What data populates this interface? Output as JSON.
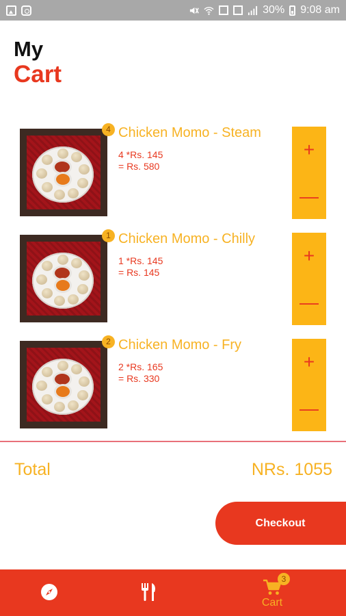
{
  "status_bar": {
    "battery": "30%",
    "time": "9:08 am",
    "icons": [
      "gallery-icon",
      "instagram-icon",
      "mute-icon",
      "wifi-icon",
      "nfc-icon",
      "sim-icon",
      "signal-icon",
      "battery-icon"
    ]
  },
  "header": {
    "title_line1": "My",
    "title_line2": "Cart"
  },
  "cart": {
    "items": [
      {
        "quantity": "4",
        "name": "Chicken Momo - Steam",
        "calc": "4 *Rs. 145",
        "subtotal": "= Rs. 580"
      },
      {
        "quantity": "1",
        "name": "Chicken Momo - Chilly",
        "calc": "1 *Rs. 145",
        "subtotal": "= Rs. 145"
      },
      {
        "quantity": "2",
        "name": "Chicken Momo - Fry",
        "calc": "2 *Rs. 165",
        "subtotal": "= Rs. 330"
      }
    ],
    "plus_label": "+",
    "minus_label": "—"
  },
  "summary": {
    "total_label": "Total",
    "total_value": "NRs. 1055",
    "checkout_label": "Checkout"
  },
  "bottom_nav": {
    "items": [
      {
        "icon": "compass-icon"
      },
      {
        "icon": "fork-knife-icon"
      },
      {
        "icon": "cart-icon",
        "label": "Cart",
        "badge": "3"
      }
    ]
  },
  "colors": {
    "accent_red": "#e8381f",
    "accent_yellow": "#f7b223",
    "stepper_yellow": "#fcb516",
    "status_bar": "#a8a8a8"
  }
}
